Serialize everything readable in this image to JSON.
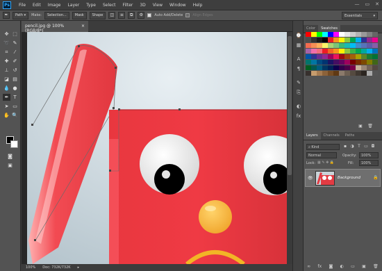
{
  "app": {
    "logo": "Ps"
  },
  "menu": [
    "File",
    "Edit",
    "Image",
    "Layer",
    "Type",
    "Select",
    "Filter",
    "3D",
    "View",
    "Window",
    "Help"
  ],
  "window_controls": [
    "—",
    "▭",
    "✕"
  ],
  "options": {
    "mode": "Path",
    "make_label": "Make:",
    "selection": "Selection...",
    "mask": "Mask",
    "shape": "Shape",
    "auto_add": "Auto Add/Delete",
    "align_edges": "Align Edges",
    "workspace": "Essentials"
  },
  "document": {
    "tab_title": "pencil.jpg @ 100% (RGB/8*)",
    "tab_close": "×",
    "zoom": "100%",
    "doc_info": "Doc: 732K/732K",
    "status_arrow": "▸"
  },
  "color_panel": {
    "tabs": [
      "Color",
      "Swatches"
    ],
    "active": 1
  },
  "swatch_colors": [
    [
      "#ff0000",
      "#ffff00",
      "#00ff00",
      "#00ffff",
      "#0000ff",
      "#ff00ff",
      "#ffffff",
      "#e5e5e5",
      "#cccccc",
      "#b3b3b3",
      "#999999",
      "#808080",
      "#666666"
    ],
    [
      "#4d4d4d",
      "#333333",
      "#1a1a1a",
      "#000000",
      "#ed1c24",
      "#f7941d",
      "#fff200",
      "#8dc63f",
      "#00a651",
      "#00aeef",
      "#2e3192",
      "#92278f",
      "#ec008c"
    ],
    [
      "#f26c4f",
      "#f68e55",
      "#fbaf5c",
      "#fff467",
      "#acd372",
      "#7cc576",
      "#3bb878",
      "#1abbb4",
      "#00bff3",
      "#438cca",
      "#5574b9",
      "#605ca8",
      "#855fa8"
    ],
    [
      "#a763a8",
      "#f06eaa",
      "#f26d7d",
      "#ed1c24",
      "#f26522",
      "#f7941d",
      "#fff200",
      "#8dc63f",
      "#39b54a",
      "#00a651",
      "#00a99d",
      "#00aeef",
      "#0072bc"
    ],
    [
      "#0054a6",
      "#2e3192",
      "#662d91",
      "#92278f",
      "#9e005d",
      "#ed145b",
      "#9e0b0f",
      "#a0410d",
      "#a36209",
      "#aba000",
      "#598527",
      "#1a7b30",
      "#007236"
    ],
    [
      "#00746b",
      "#0076a3",
      "#004b80",
      "#003471",
      "#1b1464",
      "#440e62",
      "#630460",
      "#9e005d",
      "#790000",
      "#7b2e00",
      "#7d4900",
      "#827b00",
      "#406618"
    ],
    [
      "#005e20",
      "#005952",
      "#005b7f",
      "#003663",
      "#002157",
      "#0d004c",
      "#32004b",
      "#4b0049",
      "#7b0046",
      "#c7b299",
      "#998675",
      "#736357",
      "#534741"
    ],
    [
      "#37302d",
      "#c69c6d",
      "#a67c52",
      "#8c6239",
      "#754c24",
      "#603913",
      "#8b7a6b",
      "#6d5f52",
      "#554a40",
      "#403831",
      "#2b2520",
      "#aaaaaa",
      "#555555"
    ]
  ],
  "layers_panel": {
    "tabs": [
      "Layers",
      "Channels",
      "Paths"
    ],
    "active": 0,
    "kind_label": "Kind",
    "blend_mode": "Normal",
    "opacity_label": "Opacity:",
    "opacity": "100%",
    "lock_label": "Lock:",
    "fill_label": "Fill:",
    "fill": "100%",
    "layer_name": "Background"
  }
}
